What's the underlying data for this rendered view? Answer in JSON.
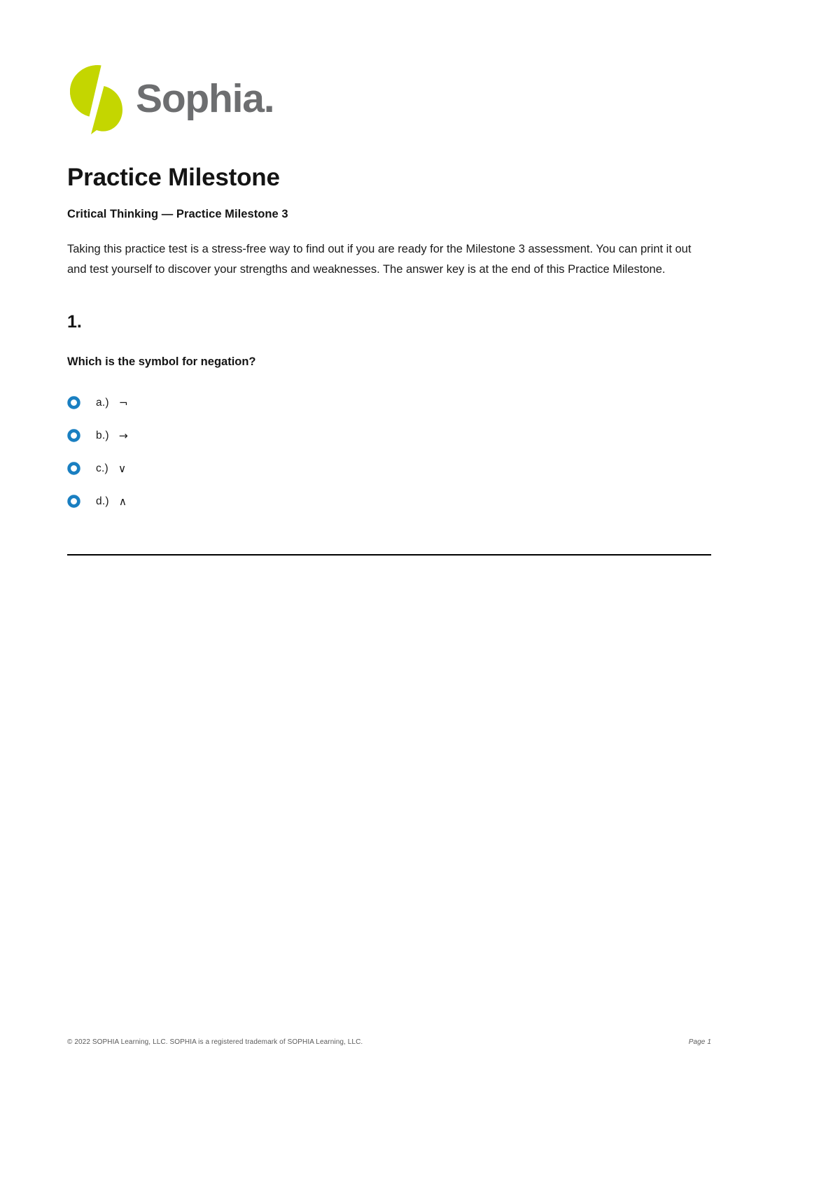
{
  "brand": {
    "name": "Sophia.",
    "logo_icon": "sophia-split-circle-logo",
    "mark_color": "#c4d600",
    "word_color": "#6d6e70"
  },
  "document": {
    "title": "Practice Milestone",
    "subtitle": "Critical Thinking — Practice Milestone 3",
    "intro": "Taking this practice test is a stress-free way to find out if you are ready for the Milestone 3 assessment. You can print it out and test yourself to discover your strengths and weaknesses. The answer key is at the end of this Practice Milestone."
  },
  "question": {
    "number": "1.",
    "prompt": "Which is the symbol for negation?",
    "radio_color": "#1a7fc1",
    "options": [
      {
        "label": "a.)",
        "symbol": "¬",
        "icon": "radio-unselected-icon"
      },
      {
        "label": "b.)",
        "symbol": "→",
        "icon": "radio-unselected-icon"
      },
      {
        "label": "c.)",
        "symbol": "∨",
        "icon": "radio-unselected-icon"
      },
      {
        "label": "d.)",
        "symbol": "∧",
        "icon": "radio-unselected-icon"
      }
    ]
  },
  "footer": {
    "copyright": "© 2022 SOPHIA Learning, LLC. SOPHIA is a registered trademark of SOPHIA Learning, LLC.",
    "page": "Page 1"
  }
}
